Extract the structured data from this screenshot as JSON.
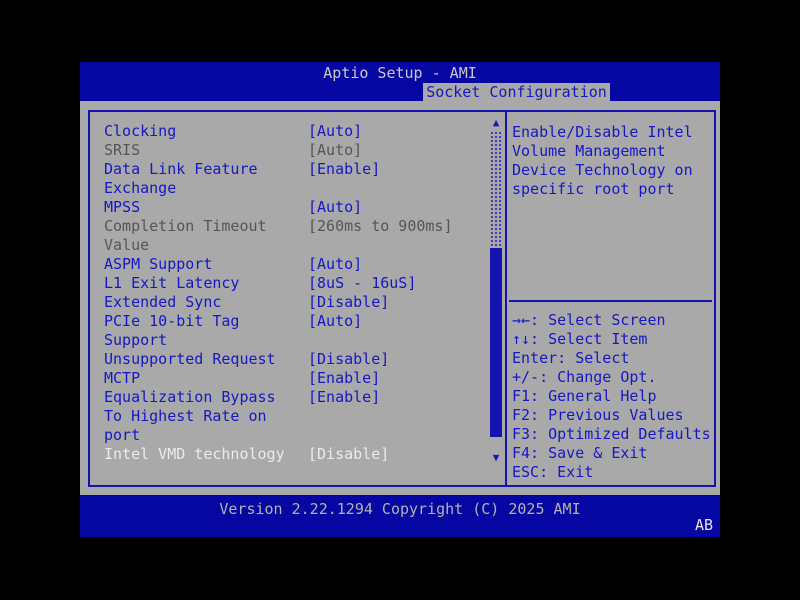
{
  "titlebar": {
    "title": "Aptio Setup - AMI"
  },
  "tab": {
    "label": "Socket Configuration"
  },
  "settings": {
    "items": [
      {
        "label": "Clocking",
        "value": "[Auto]",
        "state": "normal"
      },
      {
        "label": "SRIS",
        "value": "[Auto]",
        "state": "grayed"
      },
      {
        "label": "Data Link Feature Exchange",
        "value": "[Enable]",
        "state": "normal"
      },
      {
        "label": "MPSS",
        "value": "[Auto]",
        "state": "normal"
      },
      {
        "label": "Completion Timeout Value",
        "value": "[260ms to 900ms]",
        "state": "grayed"
      },
      {
        "label": "ASPM Support",
        "value": "[Auto]",
        "state": "normal"
      },
      {
        "label": "L1 Exit Latency",
        "value": "[8uS - 16uS]",
        "state": "normal"
      },
      {
        "label": "Extended Sync",
        "value": "[Disable]",
        "state": "normal"
      },
      {
        "label": "PCIe 10-bit Tag Support",
        "value": "[Auto]",
        "state": "normal"
      },
      {
        "label": "Unsupported Request",
        "value": "[Disable]",
        "state": "normal"
      },
      {
        "label": "MCTP",
        "value": "[Enable]",
        "state": "normal"
      },
      {
        "label": "Equalization Bypass To Highest Rate on port",
        "value": "[Enable]",
        "state": "normal"
      },
      {
        "label": "Intel VMD technology",
        "value": "[Disable]",
        "state": "selected"
      }
    ]
  },
  "help": {
    "description": "Enable/Disable Intel Volume Management Device Technology on specific root port"
  },
  "hotkeys": [
    {
      "label": "→←: Select Screen"
    },
    {
      "label": "↑↓: Select Item"
    },
    {
      "label": "Enter: Select"
    },
    {
      "label": "+/-: Change Opt."
    },
    {
      "label": "F1: General Help"
    },
    {
      "label": "F2: Previous Values"
    },
    {
      "label": "F3: Optimized Defaults"
    },
    {
      "label": "F4: Save & Exit"
    },
    {
      "label": "ESC: Exit"
    }
  ],
  "scrollbar": {
    "up_icon": "▲",
    "down_icon": "▼"
  },
  "footer": {
    "version_text": "Version 2.22.1294 Copyright (C) 2025 AMI",
    "badge": "AB"
  },
  "colors": {
    "background": "#000000",
    "header_blue": "#0606a2",
    "panel_gray": "#a9a9a9",
    "text_blue": "#1717c3",
    "grayed_text": "#55555b",
    "selected_text": "#ebebeb",
    "title_text": "#c9c9c9"
  }
}
